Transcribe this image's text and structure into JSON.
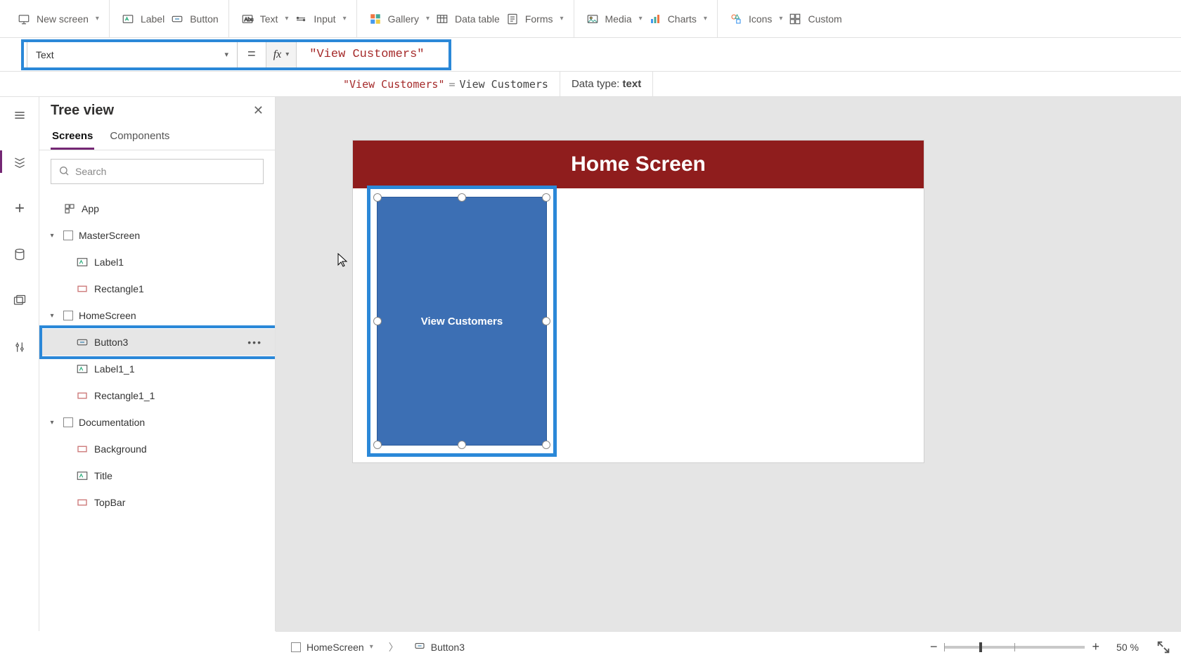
{
  "ribbon": {
    "items": [
      {
        "label": "New screen",
        "icon": "screen",
        "dropdown": true
      },
      {
        "label": "Label",
        "icon": "label",
        "dropdown": false
      },
      {
        "label": "Button",
        "icon": "button",
        "dropdown": false
      },
      {
        "label": "Text",
        "icon": "text",
        "dropdown": true
      },
      {
        "label": "Input",
        "icon": "input",
        "dropdown": true
      },
      {
        "label": "Gallery",
        "icon": "gallery",
        "dropdown": true
      },
      {
        "label": "Data table",
        "icon": "datatable",
        "dropdown": false
      },
      {
        "label": "Forms",
        "icon": "forms",
        "dropdown": true
      },
      {
        "label": "Media",
        "icon": "media",
        "dropdown": true
      },
      {
        "label": "Charts",
        "icon": "charts",
        "dropdown": true
      },
      {
        "label": "Icons",
        "icon": "icons",
        "dropdown": true
      },
      {
        "label": "Custom",
        "icon": "custom",
        "dropdown": false
      }
    ]
  },
  "formula": {
    "property": "Text",
    "fx": "fx",
    "value": "\"View Customers\"",
    "result_expr": "\"View Customers\"",
    "result_eq": "=",
    "result_val": "View Customers",
    "datatype_label": "Data type:",
    "datatype_value": "text"
  },
  "tree": {
    "title": "Tree view",
    "tabs": {
      "screens": "Screens",
      "components": "Components"
    },
    "search_placeholder": "Search",
    "items": [
      {
        "label": "App",
        "depth": 0,
        "icon": "app"
      },
      {
        "label": "MasterScreen",
        "depth": 0,
        "icon": "screen",
        "expandable": true
      },
      {
        "label": "Label1",
        "depth": 2,
        "icon": "label"
      },
      {
        "label": "Rectangle1",
        "depth": 2,
        "icon": "rect"
      },
      {
        "label": "HomeScreen",
        "depth": 0,
        "icon": "screen",
        "expandable": true
      },
      {
        "label": "Button3",
        "depth": 2,
        "icon": "button",
        "selected": true
      },
      {
        "label": "Label1_1",
        "depth": 2,
        "icon": "label"
      },
      {
        "label": "Rectangle1_1",
        "depth": 2,
        "icon": "rect"
      },
      {
        "label": "Documentation",
        "depth": 0,
        "icon": "screen",
        "expandable": true
      },
      {
        "label": "Background",
        "depth": 2,
        "icon": "rect"
      },
      {
        "label": "Title",
        "depth": 2,
        "icon": "label"
      },
      {
        "label": "TopBar",
        "depth": 2,
        "icon": "rect"
      }
    ]
  },
  "canvas": {
    "header_title": "Home Screen",
    "button_text": "View Customers"
  },
  "status": {
    "crumb_screen": "HomeScreen",
    "crumb_element": "Button3",
    "zoom_minus": "−",
    "zoom_plus": "+",
    "zoom_value": "50",
    "zoom_unit": "%"
  }
}
